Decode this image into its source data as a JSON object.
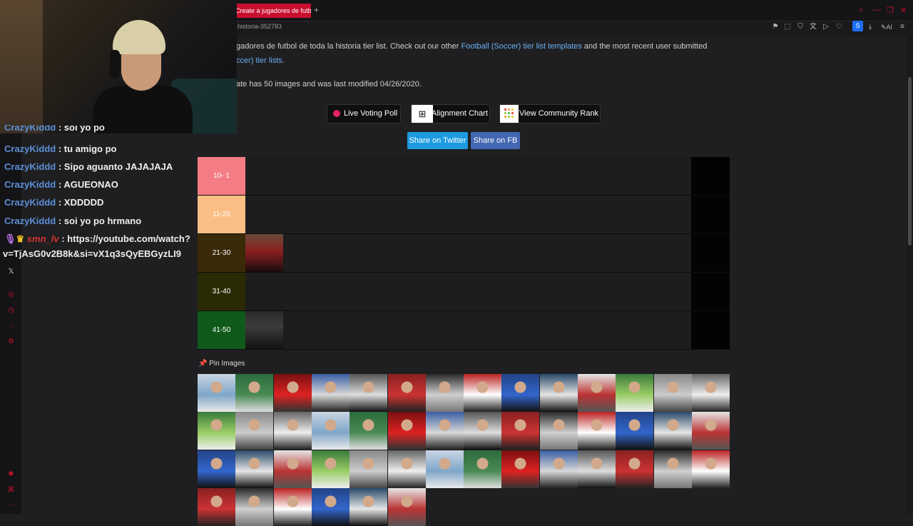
{
  "browser": {
    "tab_title": "Create a jugadores de futb",
    "address": "-historia-352783",
    "extension_badge": "S",
    "ai_label": "AI"
  },
  "description": {
    "line1_prefix": "gadores de futbol de toda la historia tier list. Check out our other ",
    "line1_link": "Football (Soccer) tier list templates",
    "line1_suffix": " and the most recent user submitted",
    "line2_link": "ccer) tier lists",
    "line2_suffix": ".",
    "line3": "ate has 50 images and was last modified 04/26/2020."
  },
  "actions": {
    "live_voting": "Live Voting Poll",
    "alignment_chart": "Alignment Chart",
    "community_rank": "View Community Rank",
    "share_twitter": "Share on Twitter",
    "share_fb": "Share on FB"
  },
  "tiers": [
    {
      "label": "10- 1",
      "color": "#f37c85",
      "items": 0
    },
    {
      "label": "11-20",
      "color": "#fbbf85",
      "items": 0
    },
    {
      "label": "21-30",
      "color": "#3a2a08",
      "items": 1
    },
    {
      "label": "31-40",
      "color": "#2a2a05",
      "items": 0
    },
    {
      "label": "41-50",
      "color": "#0f5a1a",
      "items": 1
    }
  ],
  "pin_images_label": "Pin Images",
  "chat": [
    {
      "user": "CrazyKiddd",
      "message": ": soi yo po"
    },
    {
      "user": "CrazyKiddd",
      "message": ": tu amigo po"
    },
    {
      "user": "CrazyKiddd",
      "message": ": Sipo aguanto JAJAJAJA"
    },
    {
      "user": "CrazyKiddd",
      "message": ": AGUEONAO"
    },
    {
      "user": "CrazyKiddd",
      "message": ": XDDDDD"
    },
    {
      "user": "CrazyKiddd",
      "message": ": soi yo po hrmano"
    },
    {
      "user": "smn_lv",
      "message": ": https://youtube.com/watch?"
    },
    {
      "user": "",
      "message": "v=TjAsG0v2B8k&si=vX1q3sQyEBGyzLI9"
    }
  ],
  "colors": {
    "accent_red": "#c8102e",
    "link": "#6ab0f3",
    "twitter": "#1d9be1",
    "facebook": "#4267b2"
  }
}
